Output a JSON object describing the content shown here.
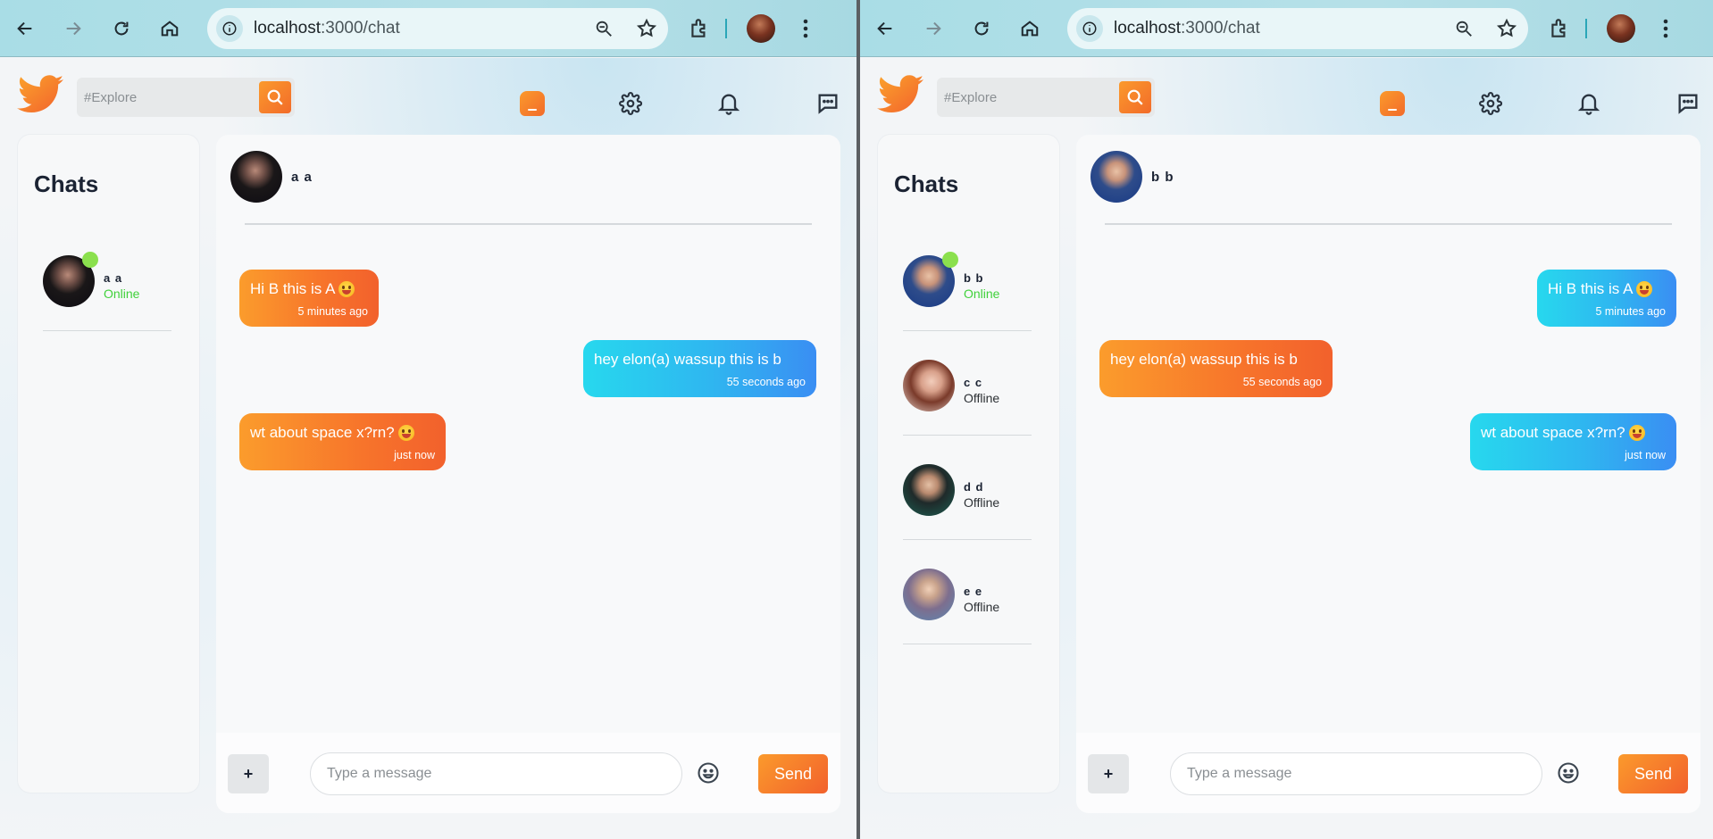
{
  "windows": [
    {
      "browser": {
        "url_host": "localhost",
        "url_path": ":3000/chat"
      },
      "app": {
        "search_placeholder": "#Explore",
        "sidebar_title": "Chats",
        "contacts": [
          {
            "name": "a a",
            "status": "Online",
            "avatar": "elon"
          }
        ],
        "header_name": "a a",
        "header_avatar": "elon",
        "messages": [
          {
            "text": "Hi B this is A",
            "emoji": true,
            "time": "5 minutes ago",
            "side": "left",
            "color": "orange"
          },
          {
            "text": "hey elon(a) wassup this is b",
            "emoji": false,
            "time": "55 seconds ago",
            "side": "right",
            "color": "blue"
          },
          {
            "text": "wt about space x?rn?",
            "emoji": true,
            "time": "just now",
            "side": "left",
            "color": "orange"
          }
        ],
        "plus_label": "+",
        "input_placeholder": "Type a message",
        "send_label": "Send"
      }
    },
    {
      "browser": {
        "url_host": "localhost",
        "url_path": ":3000/chat"
      },
      "app": {
        "search_placeholder": "#Explore",
        "sidebar_title": "Chats",
        "contacts": [
          {
            "name": "b b",
            "status": "Online",
            "avatar": "mark"
          },
          {
            "name": "c c",
            "status": "Offline",
            "avatar": "woman1"
          },
          {
            "name": "d d",
            "status": "Offline",
            "avatar": "woman2"
          },
          {
            "name": "e e",
            "status": "Offline",
            "avatar": "woman3"
          }
        ],
        "header_name": "b b",
        "header_avatar": "mark",
        "messages": [
          {
            "text": "Hi B this is A",
            "emoji": true,
            "time": "5 minutes ago",
            "side": "right",
            "color": "blue"
          },
          {
            "text": "hey elon(a) wassup this is b",
            "emoji": false,
            "time": "55 seconds ago",
            "side": "left",
            "color": "orange"
          },
          {
            "text": "wt about space x?rn?",
            "emoji": true,
            "time": "just now",
            "side": "right",
            "color": "blue"
          }
        ],
        "plus_label": "+",
        "input_placeholder": "Type a message",
        "send_label": "Send"
      }
    }
  ],
  "colors": {
    "accent_orange": "#f7742b",
    "accent_blue": "#2fb6f0",
    "online_green": "#3fd13a",
    "status_dot": "#8be04e"
  }
}
